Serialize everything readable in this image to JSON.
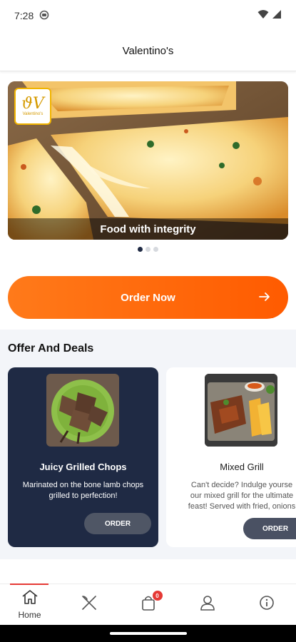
{
  "status_bar": {
    "time": "7:28"
  },
  "header": {
    "title": "Valentino's"
  },
  "hero": {
    "caption": "Food with integrity",
    "logo_text": "Valentino's",
    "slide_count": 3,
    "active_slide": 0
  },
  "order_now": {
    "label": "Order Now"
  },
  "deals": {
    "title": "Offer And Deals",
    "items": [
      {
        "title": "Juicy Grilled Chops",
        "description": "Marinated on the bone lamb chops grilled to perfection!",
        "button": "ORDER"
      },
      {
        "title": "Mixed Grill",
        "description_lines": [
          "Can't decide? Indulge yourse",
          "our mixed grill for the ultimate",
          "feast! Served with fried, onions"
        ],
        "button": "ORDER"
      }
    ]
  },
  "bottom_nav": {
    "items": [
      {
        "label": "Home",
        "icon": "home-icon"
      },
      {
        "label": "",
        "icon": "utensils-icon"
      },
      {
        "label": "",
        "icon": "bag-icon",
        "badge": "0"
      },
      {
        "label": "",
        "icon": "user-icon"
      },
      {
        "label": "",
        "icon": "info-icon"
      }
    ]
  },
  "colors": {
    "accent": "#ff6a0d",
    "card_dark": "#1f2a44",
    "badge": "#e53935"
  }
}
